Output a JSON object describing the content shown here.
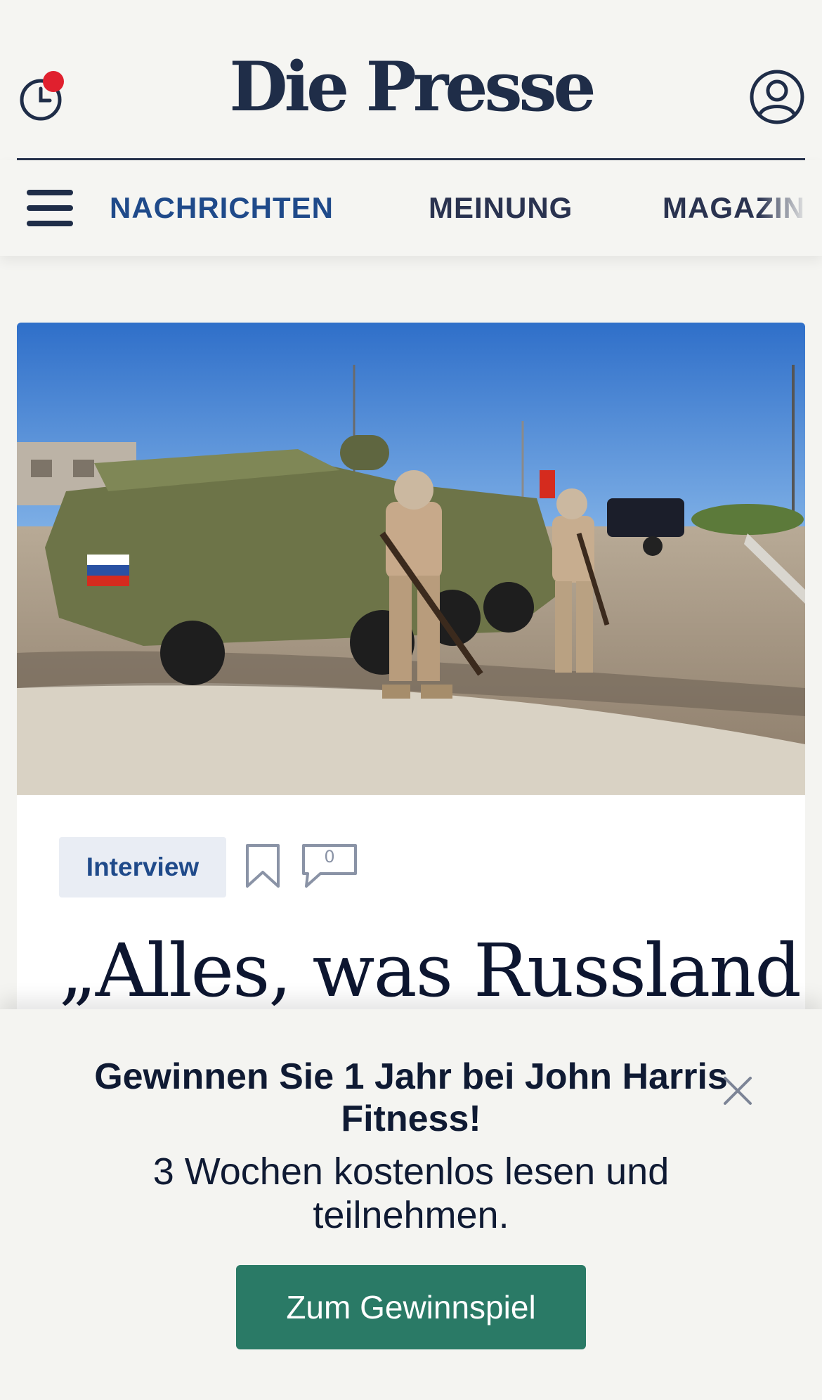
{
  "header": {
    "brand": "Die Presse",
    "history_icon": "clock-icon",
    "notification_dot_color": "#e0202e",
    "account_icon": "user-circle-icon"
  },
  "nav": {
    "menu_icon": "hamburger-menu-icon",
    "items": [
      {
        "label": "NACHRICHTEN",
        "active": true
      },
      {
        "label": "MEINUNG",
        "active": false
      },
      {
        "label": "MAGAZIN",
        "active": false
      }
    ]
  },
  "article": {
    "tag": "Interview",
    "bookmark_icon": "bookmark-icon",
    "comment_icon": "comment-icon",
    "comment_count": "0",
    "headline": "„Alles, was Russland",
    "image": "photo: two soldiers with rifles standing beside an armored vehicle with Russian flags"
  },
  "promo": {
    "title": "Gewinnen Sie 1 Jahr bei John Harris Fitness!",
    "subtitle": "3 Wochen kostenlos lesen und teilnehmen.",
    "cta_label": "Zum Gewinnspiel",
    "close_icon": "close-icon"
  },
  "colors": {
    "brand_navy": "#1f2d48",
    "nav_active": "#1f4a8a",
    "cta_green": "#2a7a66",
    "background": "#f4f4f1"
  }
}
